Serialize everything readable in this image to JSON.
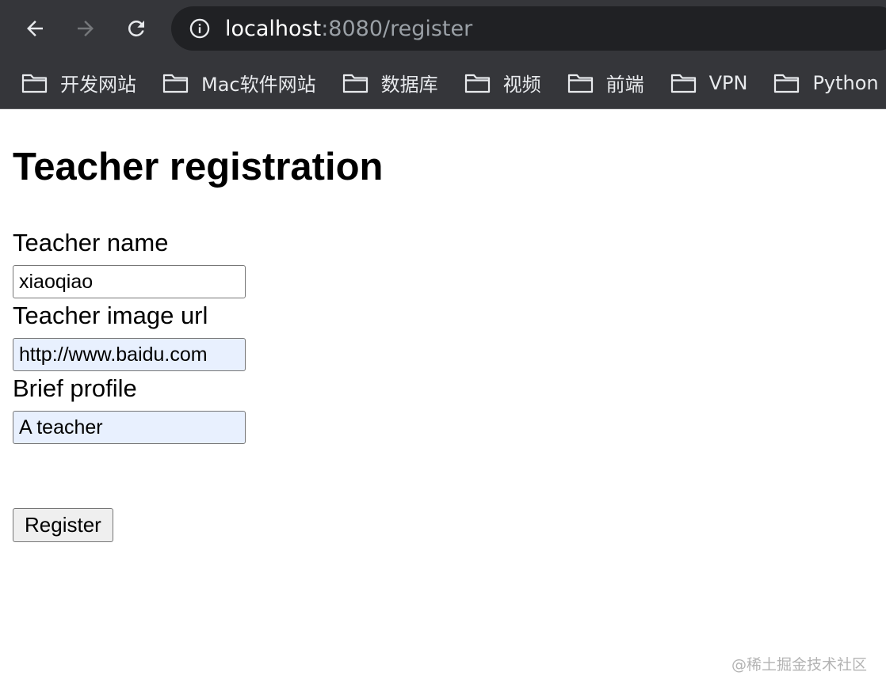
{
  "browser": {
    "url_host": "localhost",
    "url_rest": ":8080/register",
    "bookmarks": [
      {
        "label": "开发网站"
      },
      {
        "label": "Mac软件网站"
      },
      {
        "label": "数据库"
      },
      {
        "label": "视频"
      },
      {
        "label": "前端"
      },
      {
        "label": "VPN"
      },
      {
        "label": "Python"
      }
    ]
  },
  "page": {
    "title": "Teacher registration",
    "fields": [
      {
        "label": "Teacher name",
        "value": "xiaoqiao"
      },
      {
        "label": "Teacher image url",
        "value": "http://www.baidu.com"
      },
      {
        "label": "Brief profile",
        "value": "A teacher"
      }
    ],
    "submit_label": "Register"
  },
  "watermark": "@稀土掘金技术社区",
  "colors": {
    "chrome_bg": "#35363a",
    "omnibox_bg": "#202124",
    "autofill_bg": "#e8f0fe"
  }
}
